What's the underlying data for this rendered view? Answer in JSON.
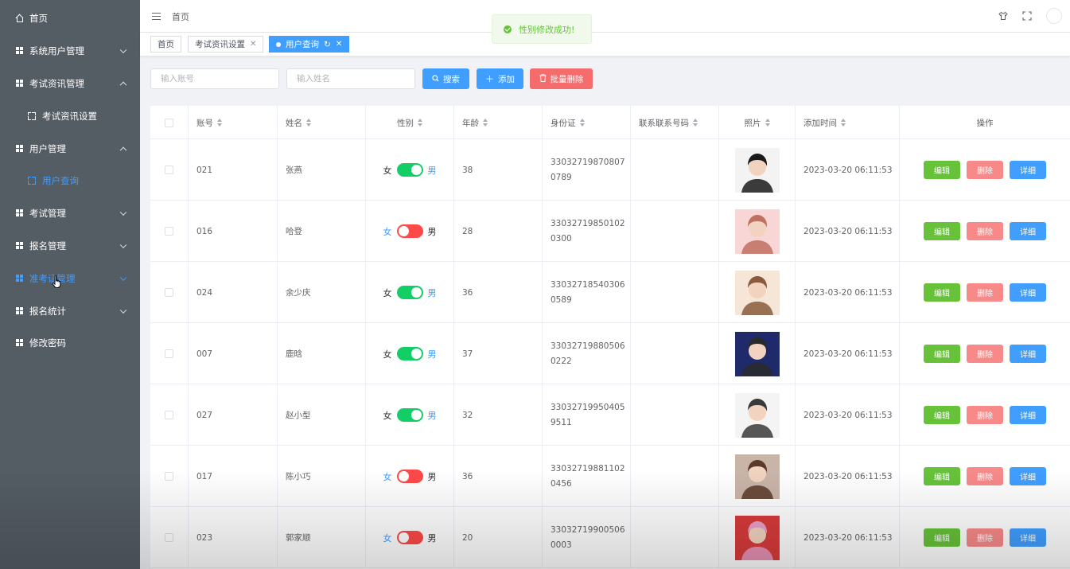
{
  "sidebar": {
    "items": [
      {
        "label": "首页"
      },
      {
        "label": "系统用户管理"
      },
      {
        "label": "考试资讯管理"
      },
      {
        "label": "考试资讯设置"
      },
      {
        "label": "用户管理"
      },
      {
        "label": "用户查询"
      },
      {
        "label": "考试管理"
      },
      {
        "label": "报名管理"
      },
      {
        "label": "准考证管理"
      },
      {
        "label": "报名统计"
      },
      {
        "label": "修改密码"
      }
    ]
  },
  "header": {
    "breadcrumb": "首页"
  },
  "tags": [
    {
      "label": "首页"
    },
    {
      "label": "考试资讯设置"
    },
    {
      "label": "用户查询"
    }
  ],
  "toast": {
    "message": "性别修改成功!"
  },
  "search": {
    "account_placeholder": "输入账号",
    "name_placeholder": "输入姓名",
    "search_label": "搜索",
    "add_label": "添加",
    "batch_delete_label": "批量删除"
  },
  "table": {
    "columns": [
      "账号",
      "姓名",
      "性别",
      "年龄",
      "身份证",
      "联系联系号码",
      "照片",
      "添加时间",
      "操作"
    ],
    "female_label": "女",
    "male_label": "男",
    "edit_label": "编辑",
    "delete_label": "删除",
    "detail_label": "详细",
    "rows": [
      {
        "account": "021",
        "name": "张燕",
        "gender": "男",
        "age": "38",
        "id_card": "330327198708070789",
        "phone": "",
        "added": "2023-03-20 06:11:53"
      },
      {
        "account": "016",
        "name": "哈登",
        "gender": "女",
        "age": "28",
        "id_card": "330327198501020300",
        "phone": "",
        "added": "2023-03-20 06:11:53"
      },
      {
        "account": "024",
        "name": "余少庆",
        "gender": "男",
        "age": "36",
        "id_card": "330327185403060589",
        "phone": "",
        "added": "2023-03-20 06:11:53"
      },
      {
        "account": "007",
        "name": "鹿晗",
        "gender": "男",
        "age": "37",
        "id_card": "330327198805060222",
        "phone": "",
        "added": "2023-03-20 06:11:53"
      },
      {
        "account": "027",
        "name": "赵小型",
        "gender": "男",
        "age": "32",
        "id_card": "330327199504059511",
        "phone": "",
        "added": "2023-03-20 06:11:53"
      },
      {
        "account": "017",
        "name": "陈小巧",
        "gender": "女",
        "age": "36",
        "id_card": "330327198811020456",
        "phone": "",
        "added": "2023-03-20 06:11:53"
      },
      {
        "account": "023",
        "name": "郭家顺",
        "gender": "女",
        "age": "20",
        "id_card": "330327199005060003",
        "phone": "",
        "added": "2023-03-20 06:11:53"
      }
    ]
  },
  "colors": {
    "sidebar_bg": "#545c64",
    "primary": "#409eff",
    "success": "#67c23a",
    "danger_light": "#f78989",
    "switch_on": "#13ce66",
    "switch_off": "#ff4949"
  }
}
